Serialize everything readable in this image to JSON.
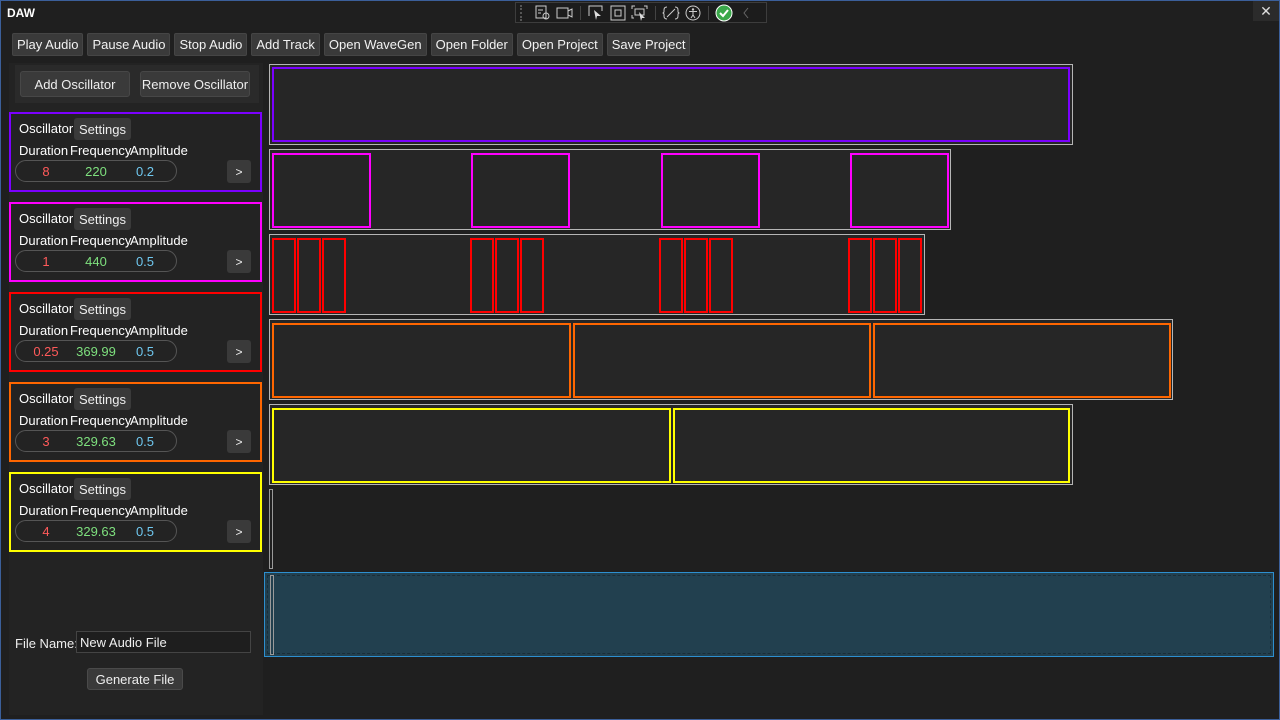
{
  "window": {
    "title": "DAW",
    "close_icon": "close-icon"
  },
  "devtools": {
    "icons": [
      "select-element-icon",
      "record-video-icon",
      "pointer-select-icon",
      "layout-adorner-icon",
      "track-focus-icon",
      "binding-failures-icon",
      "accessibility-icon",
      "check-ok-icon",
      "collapse-chevron-icon"
    ]
  },
  "toolbar": {
    "play": "Play Audio",
    "pause": "Pause Audio",
    "stop": "Stop Audio",
    "add_track": "Add Track",
    "open_wavegen": "Open WaveGen",
    "open_folder": "Open Folder",
    "open_project": "Open Project",
    "save_project": "Save Project"
  },
  "oscillator_panel": {
    "add": "Add Oscillator",
    "remove": "Remove Oscillator",
    "oscillators": [
      {
        "label": "Oscillator",
        "settings": "Settings",
        "h_duration": "Duration",
        "h_frequency": "Frequency",
        "h_amplitude": "Amplitude",
        "duration": "8",
        "frequency": "220",
        "amplitude": "0.2",
        "next": ">",
        "color": "#7b00ff"
      },
      {
        "label": "Oscillator",
        "settings": "Settings",
        "h_duration": "Duration",
        "h_frequency": "Frequency",
        "h_amplitude": "Amplitude",
        "duration": "1",
        "frequency": "440",
        "amplitude": "0.5",
        "next": ">",
        "color": "#ff00ff"
      },
      {
        "label": "Oscillator",
        "settings": "Settings",
        "h_duration": "Duration",
        "h_frequency": "Frequency",
        "h_amplitude": "Amplitude",
        "duration": "0.25",
        "frequency": "369.99",
        "amplitude": "0.5",
        "next": ">",
        "color": "#ff0000"
      },
      {
        "label": "Oscillator",
        "settings": "Settings",
        "h_duration": "Duration",
        "h_frequency": "Frequency",
        "h_amplitude": "Amplitude",
        "duration": "3",
        "frequency": "329.63",
        "amplitude": "0.5",
        "next": ">",
        "color": "#ff6600"
      },
      {
        "label": "Oscillator",
        "settings": "Settings",
        "h_duration": "Duration",
        "h_frequency": "Frequency",
        "h_amplitude": "Amplitude",
        "duration": "4",
        "frequency": "329.63",
        "amplitude": "0.5",
        "next": ">",
        "color": "#ffff00"
      }
    ],
    "value_colors": {
      "duration": "#ff5a5a",
      "frequency": "#7ee07e",
      "amplitude": "#6fc8f0"
    }
  },
  "file": {
    "label": "File Name:",
    "value": "New Audio File",
    "generate": "Generate File"
  },
  "timeline": {
    "tracks": [
      {
        "color": "#7b00ff",
        "clip_count": 1
      },
      {
        "color": "#ff00ff",
        "clip_count": 4
      },
      {
        "color": "#ff0000",
        "clip_count": 12
      },
      {
        "color": "#ff6600",
        "clip_count": 3
      },
      {
        "color": "#ffff00",
        "clip_count": 2
      },
      {
        "color": "#9a9a9a",
        "clip_count": 0
      }
    ],
    "drop_zone_color": "#2d8fcf"
  }
}
